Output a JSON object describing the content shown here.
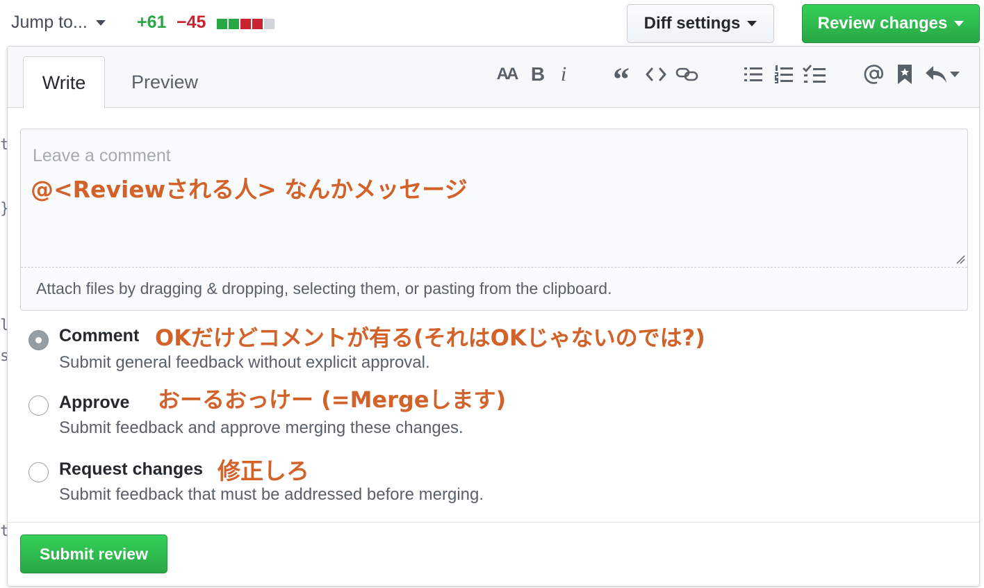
{
  "topbar": {
    "jump_label": "Jump to...",
    "additions": "+61",
    "deletions": "−45",
    "diffstat_blocks": [
      "#28a745",
      "#28a745",
      "#cb2431",
      "#cb2431",
      "#d1d5da"
    ],
    "diff_settings_label": "Diff settings",
    "review_changes_label": "Review changes"
  },
  "edge_fragments": [
    "t",
    "}",
    "l",
    "s",
    "t"
  ],
  "review": {
    "tabs": [
      {
        "label": "Write",
        "active": true
      },
      {
        "label": "Preview",
        "active": false
      }
    ],
    "toolbar": {
      "header_label": "AA",
      "bold_label": "B",
      "italic_label": "i",
      "quote_label": "“"
    },
    "comment": {
      "placeholder": "Leave a comment",
      "attach_hint": "Attach files by dragging & dropping, selecting them, or pasting from the clipboard."
    },
    "options": [
      {
        "label": "Comment",
        "description": "Submit general feedback without explicit approval.",
        "checked": true
      },
      {
        "label": "Approve",
        "description": "Submit feedback and approve merging these changes.",
        "checked": false
      },
      {
        "label": "Request changes",
        "description": "Submit feedback that must be addressed before merging.",
        "checked": false
      }
    ],
    "submit_label": "Submit review"
  },
  "annotations": {
    "comment_box": "@<Reviewされる人> なんかメッセージ",
    "comment_option": "OKだけどコメントが有る(それはOKじゃないのでは?)",
    "approve_option": "おーるおっけー (=Mergeします)",
    "request_changes_option": "修正しろ",
    "color": "#d2622a"
  },
  "colors": {
    "green": "#28a745",
    "red": "#cb2431",
    "muted": "#586069"
  }
}
